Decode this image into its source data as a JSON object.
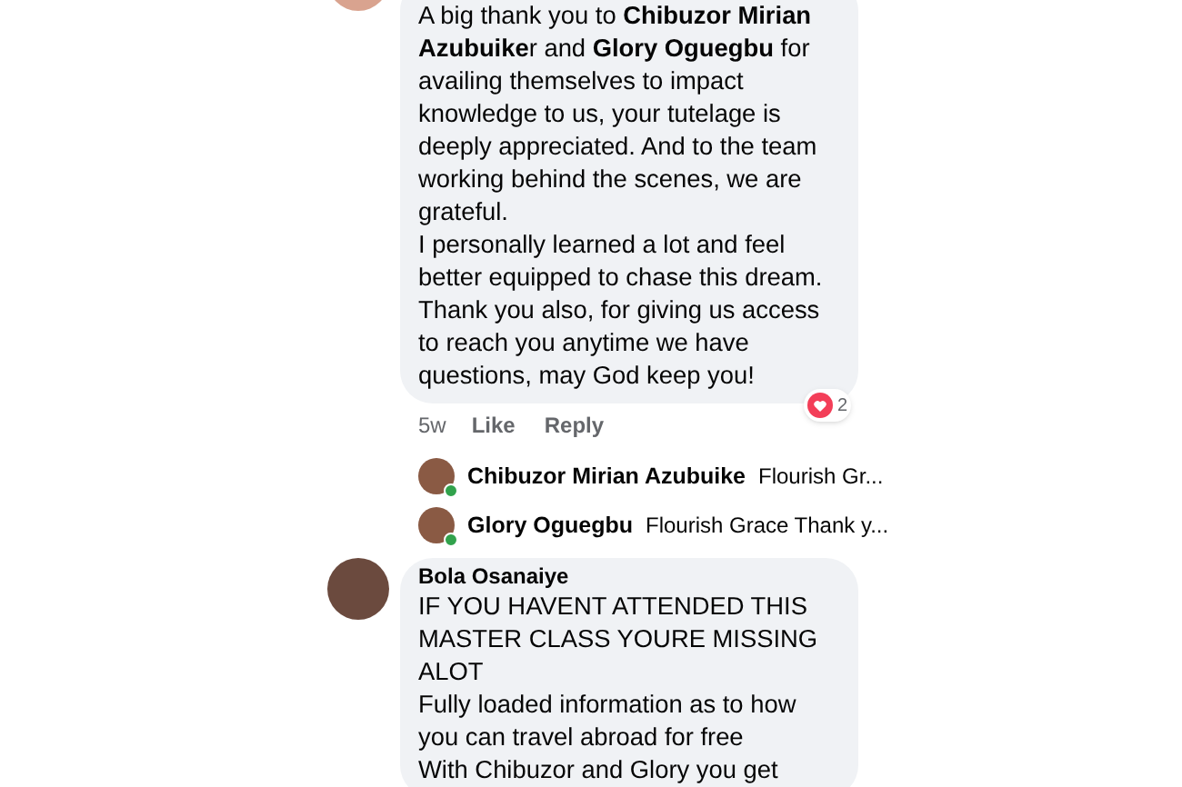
{
  "comments": [
    {
      "paragraphs": [
        "A big thank you to **Chibuzor Mirian Azubuike**r and **Glory Oguegbu** for availing themselves to impact knowledge to us, your tutelage is deeply appreciated. And to the team working behind the scenes, we are grateful.",
        "I personally learned a lot and feel better equipped to chase this dream. Thank you also, for giving us access to reach you anytime we have questions, may God keep you!"
      ],
      "time": "5w",
      "actions": [
        "Like",
        "Reply"
      ],
      "reactions": "2",
      "replies": [
        {
          "author": "Chibuzor Mirian Azubuike",
          "preview": "Flourish Gr...",
          "online": true
        },
        {
          "author": "Glory Oguegbu",
          "preview": "Flourish Grace Thank y...",
          "online": true
        }
      ]
    },
    {
      "author": "Bola Osanaiye",
      "paragraphs": [
        "IF YOU HAVENT ATTENDED THIS MASTER CLASS YOURE MISSING ALOT",
        "Fully loaded information as to how you can travel abroad for free",
        "With Chibuzor and Glory you get"
      ]
    }
  ]
}
